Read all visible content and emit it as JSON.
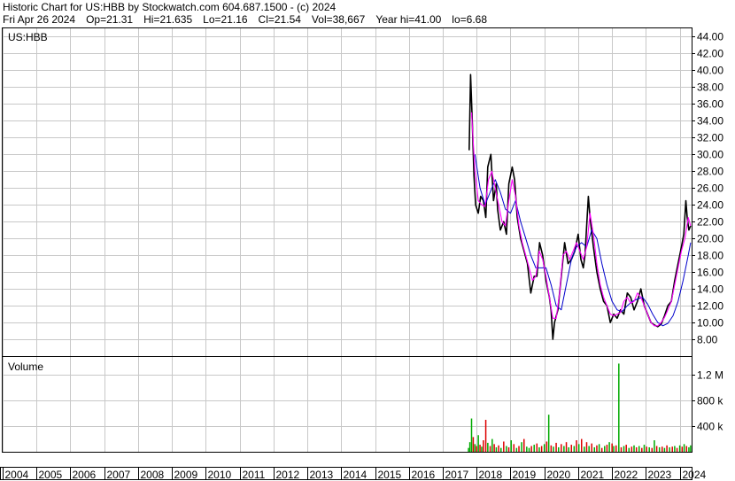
{
  "header": {
    "line1": "Historic Chart for US:HBB by Stockwatch.com 604.687.1500 - (c) 2024",
    "date": "Fri Apr 26 2024",
    "open": "Op=21.31",
    "high": "Hi=21.635",
    "low": "Lo=21.16",
    "close": "Cl=21.54",
    "volume": "Vol=38,667",
    "year_hi": "Year hi=41.00",
    "year_lo": "lo=6.68"
  },
  "colors": {
    "price": "#000000",
    "ma_short": "#ff00ff",
    "ma_long": "#0000cc",
    "vol_up": "#00aa00",
    "vol_down": "#dd0000",
    "grid": "#c8c8c8"
  },
  "chart_data": [
    {
      "type": "line",
      "title": "US:HBB",
      "x_labels": [
        "2004",
        "2005",
        "2006",
        "2007",
        "2008",
        "2009",
        "2010",
        "2011",
        "2012",
        "2013",
        "2014",
        "2015",
        "2016",
        "2017",
        "2018",
        "2019",
        "2020",
        "2021",
        "2022",
        "2023",
        "2024"
      ],
      "y_ticks": [
        "8.00",
        "10.00",
        "12.00",
        "14.00",
        "16.00",
        "18.00",
        "20.00",
        "22.00",
        "24.00",
        "26.00",
        "28.00",
        "30.00",
        "32.00",
        "34.00",
        "36.00",
        "38.00",
        "40.00",
        "42.00",
        "44.00"
      ],
      "ylim": [
        6,
        45
      ],
      "xlim": [
        2004.0,
        2024.35
      ],
      "grid": true,
      "series": [
        {
          "style": "close",
          "x": [
            2017.78,
            2017.82,
            2017.87,
            2017.92,
            2017.97,
            2018.05,
            2018.12,
            2018.2,
            2018.27,
            2018.33,
            2018.42,
            2018.5,
            2018.58,
            2018.62,
            2018.7,
            2018.8,
            2018.88,
            2018.95,
            2019.05,
            2019.12,
            2019.2,
            2019.3,
            2019.4,
            2019.5,
            2019.6,
            2019.7,
            2019.78,
            2019.86,
            2019.95,
            2020.05,
            2020.15,
            2020.2,
            2020.25,
            2020.3,
            2020.4,
            2020.5,
            2020.6,
            2020.7,
            2020.8,
            2020.9,
            2021.0,
            2021.08,
            2021.15,
            2021.2,
            2021.25,
            2021.3,
            2021.35,
            2021.45,
            2021.55,
            2021.65,
            2021.75,
            2021.85,
            2021.95,
            2022.05,
            2022.15,
            2022.25,
            2022.35,
            2022.45,
            2022.55,
            2022.65,
            2022.75,
            2022.85,
            2022.95,
            2023.05,
            2023.15,
            2023.25,
            2023.35,
            2023.45,
            2023.55,
            2023.65,
            2023.75,
            2023.85,
            2023.95,
            2024.05,
            2024.12,
            2024.18,
            2024.22,
            2024.27,
            2024.32
          ],
          "y": [
            30.5,
            39.5,
            34.0,
            27.5,
            24.0,
            23.0,
            25.0,
            24.5,
            22.5,
            28.5,
            30.0,
            24.5,
            26.5,
            23.5,
            21.0,
            22.0,
            20.5,
            26.5,
            28.5,
            27.0,
            22.5,
            20.0,
            18.5,
            17.0,
            13.5,
            15.5,
            15.5,
            19.5,
            18.0,
            15.0,
            13.0,
            11.5,
            8.0,
            10.0,
            11.5,
            15.5,
            19.5,
            17.0,
            17.5,
            18.5,
            20.5,
            17.5,
            16.5,
            18.0,
            21.5,
            25.0,
            22.5,
            19.0,
            16.0,
            14.0,
            12.5,
            12.0,
            10.0,
            11.0,
            10.5,
            11.5,
            11.0,
            13.5,
            13.0,
            11.5,
            12.5,
            14.0,
            12.0,
            11.0,
            10.0,
            9.7,
            9.5,
            9.8,
            10.8,
            12.0,
            12.5,
            15.0,
            17.0,
            19.0,
            20.5,
            24.5,
            22.5,
            21.0,
            21.5
          ]
        },
        {
          "style": "ma_short",
          "x": [
            2017.85,
            2017.95,
            2018.05,
            2018.15,
            2018.25,
            2018.35,
            2018.45,
            2018.55,
            2018.65,
            2018.75,
            2018.85,
            2018.95,
            2019.05,
            2019.15,
            2019.25,
            2019.35,
            2019.45,
            2019.55,
            2019.65,
            2019.75,
            2019.85,
            2019.95,
            2020.05,
            2020.15,
            2020.25,
            2020.35,
            2020.45,
            2020.55,
            2020.65,
            2020.75,
            2020.85,
            2020.95,
            2021.05,
            2021.15,
            2021.25,
            2021.35,
            2021.45,
            2021.55,
            2021.65,
            2021.75,
            2021.85,
            2021.95,
            2022.05,
            2022.15,
            2022.25,
            2022.35,
            2022.45,
            2022.55,
            2022.65,
            2022.75,
            2022.85,
            2022.95,
            2023.05,
            2023.15,
            2023.25,
            2023.35,
            2023.45,
            2023.55,
            2023.65,
            2023.75,
            2023.85,
            2023.95,
            2024.05,
            2024.15,
            2024.25,
            2024.32
          ],
          "y": [
            35.0,
            28.0,
            24.5,
            24.0,
            23.8,
            27.0,
            28.0,
            26.0,
            24.0,
            22.0,
            21.5,
            24.5,
            27.0,
            25.0,
            21.5,
            19.5,
            18.0,
            16.5,
            15.0,
            15.5,
            18.5,
            17.5,
            15.5,
            13.0,
            10.5,
            10.5,
            13.5,
            18.0,
            18.5,
            17.5,
            18.5,
            19.5,
            18.5,
            17.5,
            19.0,
            23.0,
            20.5,
            17.0,
            14.5,
            13.0,
            12.0,
            11.0,
            10.8,
            11.0,
            11.2,
            12.5,
            13.0,
            12.3,
            12.5,
            13.5,
            13.0,
            12.0,
            11.0,
            10.0,
            9.6,
            9.6,
            10.0,
            10.6,
            11.5,
            12.5,
            14.5,
            16.5,
            18.5,
            20.0,
            22.5,
            21.5
          ]
        },
        {
          "style": "ma_long",
          "x": [
            2017.95,
            2018.1,
            2018.25,
            2018.4,
            2018.55,
            2018.7,
            2018.85,
            2019.0,
            2019.15,
            2019.3,
            2019.45,
            2019.6,
            2019.75,
            2019.9,
            2020.05,
            2020.2,
            2020.35,
            2020.5,
            2020.65,
            2020.8,
            2020.95,
            2021.1,
            2021.25,
            2021.4,
            2021.55,
            2021.7,
            2021.85,
            2022.0,
            2022.15,
            2022.3,
            2022.45,
            2022.6,
            2022.75,
            2022.9,
            2023.05,
            2023.2,
            2023.35,
            2023.5,
            2023.65,
            2023.8,
            2023.95,
            2024.1,
            2024.25,
            2024.32
          ],
          "y": [
            30.0,
            26.0,
            24.0,
            25.5,
            27.0,
            25.5,
            23.5,
            23.0,
            24.5,
            22.0,
            20.0,
            18.0,
            16.5,
            16.5,
            16.5,
            14.5,
            12.0,
            11.5,
            14.5,
            17.5,
            19.0,
            19.5,
            19.0,
            21.0,
            20.0,
            17.0,
            14.5,
            12.5,
            11.5,
            11.3,
            12.0,
            12.5,
            12.8,
            13.0,
            12.2,
            11.0,
            10.0,
            9.6,
            9.9,
            10.8,
            12.5,
            15.0,
            18.0,
            19.5
          ]
        }
      ]
    },
    {
      "type": "bar",
      "title": "Volume",
      "y_ticks": [
        "400 k",
        "800 k",
        "1.2 M"
      ],
      "ylim": [
        0,
        1400000
      ],
      "x_labels": [
        "2004",
        "2005",
        "2006",
        "2007",
        "2008",
        "2009",
        "2010",
        "2011",
        "2012",
        "2013",
        "2014",
        "2015",
        "2016",
        "2017",
        "2018",
        "2019",
        "2020",
        "2021",
        "2022",
        "2023",
        "2024"
      ],
      "xlim": [
        2004.0,
        2024.35
      ],
      "bars": {
        "x": [
          2017.76,
          2017.8,
          2017.85,
          2017.9,
          2017.95,
          2018.0,
          2018.05,
          2018.1,
          2018.15,
          2018.2,
          2018.27,
          2018.33,
          2018.4,
          2018.46,
          2018.52,
          2018.58,
          2018.65,
          2018.72,
          2018.8,
          2018.88,
          2018.95,
          2019.02,
          2019.1,
          2019.18,
          2019.25,
          2019.33,
          2019.4,
          2019.48,
          2019.55,
          2019.62,
          2019.7,
          2019.78,
          2019.85,
          2019.92,
          2020.0,
          2020.07,
          2020.13,
          2020.2,
          2020.27,
          2020.35,
          2020.42,
          2020.5,
          2020.58,
          2020.65,
          2020.72,
          2020.8,
          2020.88,
          2020.95,
          2021.02,
          2021.1,
          2021.18,
          2021.25,
          2021.32,
          2021.4,
          2021.48,
          2021.55,
          2021.62,
          2021.7,
          2021.78,
          2021.85,
          2021.92,
          2022.0,
          2022.05,
          2022.12,
          2022.2,
          2022.27,
          2022.35,
          2022.42,
          2022.5,
          2022.58,
          2022.65,
          2022.72,
          2022.8,
          2022.88,
          2022.95,
          2023.02,
          2023.1,
          2023.18,
          2023.25,
          2023.32,
          2023.4,
          2023.48,
          2023.55,
          2023.62,
          2023.7,
          2023.78,
          2023.85,
          2023.92,
          2024.0,
          2024.07,
          2024.13,
          2024.2,
          2024.27,
          2024.32
        ],
        "values": [
          60000,
          150000,
          520000,
          230000,
          120000,
          90000,
          260000,
          110000,
          80000,
          180000,
          500000,
          140000,
          90000,
          200000,
          120000,
          70000,
          100000,
          60000,
          160000,
          90000,
          70000,
          180000,
          120000,
          60000,
          90000,
          150000,
          200000,
          80000,
          60000,
          90000,
          110000,
          130000,
          70000,
          90000,
          120000,
          160000,
          580000,
          100000,
          80000,
          140000,
          70000,
          120000,
          90000,
          150000,
          70000,
          110000,
          90000,
          180000,
          120000,
          200000,
          80000,
          150000,
          90000,
          130000,
          70000,
          100000,
          120000,
          60000,
          90000,
          110000,
          150000,
          130000,
          90000,
          100000,
          1380000,
          70000,
          90000,
          110000,
          60000,
          80000,
          100000,
          70000,
          90000,
          60000,
          110000,
          80000,
          70000,
          60000,
          180000,
          90000,
          70000,
          80000,
          60000,
          100000,
          70000,
          80000,
          90000,
          60000,
          100000,
          80000,
          120000,
          90000,
          70000,
          100000
        ],
        "up": [
          true,
          true,
          true,
          false,
          true,
          false,
          true,
          false,
          true,
          false,
          false,
          true,
          false,
          true,
          false,
          true,
          false,
          true,
          false,
          true,
          false,
          true,
          false,
          true,
          false,
          true,
          false,
          true,
          true,
          false,
          true,
          false,
          true,
          false,
          true,
          false,
          true,
          false,
          true,
          false,
          true,
          false,
          true,
          false,
          true,
          false,
          true,
          false,
          true,
          false,
          true,
          false,
          true,
          false,
          true,
          false,
          true,
          false,
          true,
          false,
          true,
          false,
          true,
          false,
          true,
          false,
          true,
          false,
          true,
          false,
          true,
          false,
          true,
          false,
          true,
          false,
          true,
          false,
          true,
          false,
          true,
          false,
          true,
          false,
          true,
          false,
          true,
          false,
          true,
          false,
          true,
          false,
          true,
          true
        ]
      }
    }
  ]
}
